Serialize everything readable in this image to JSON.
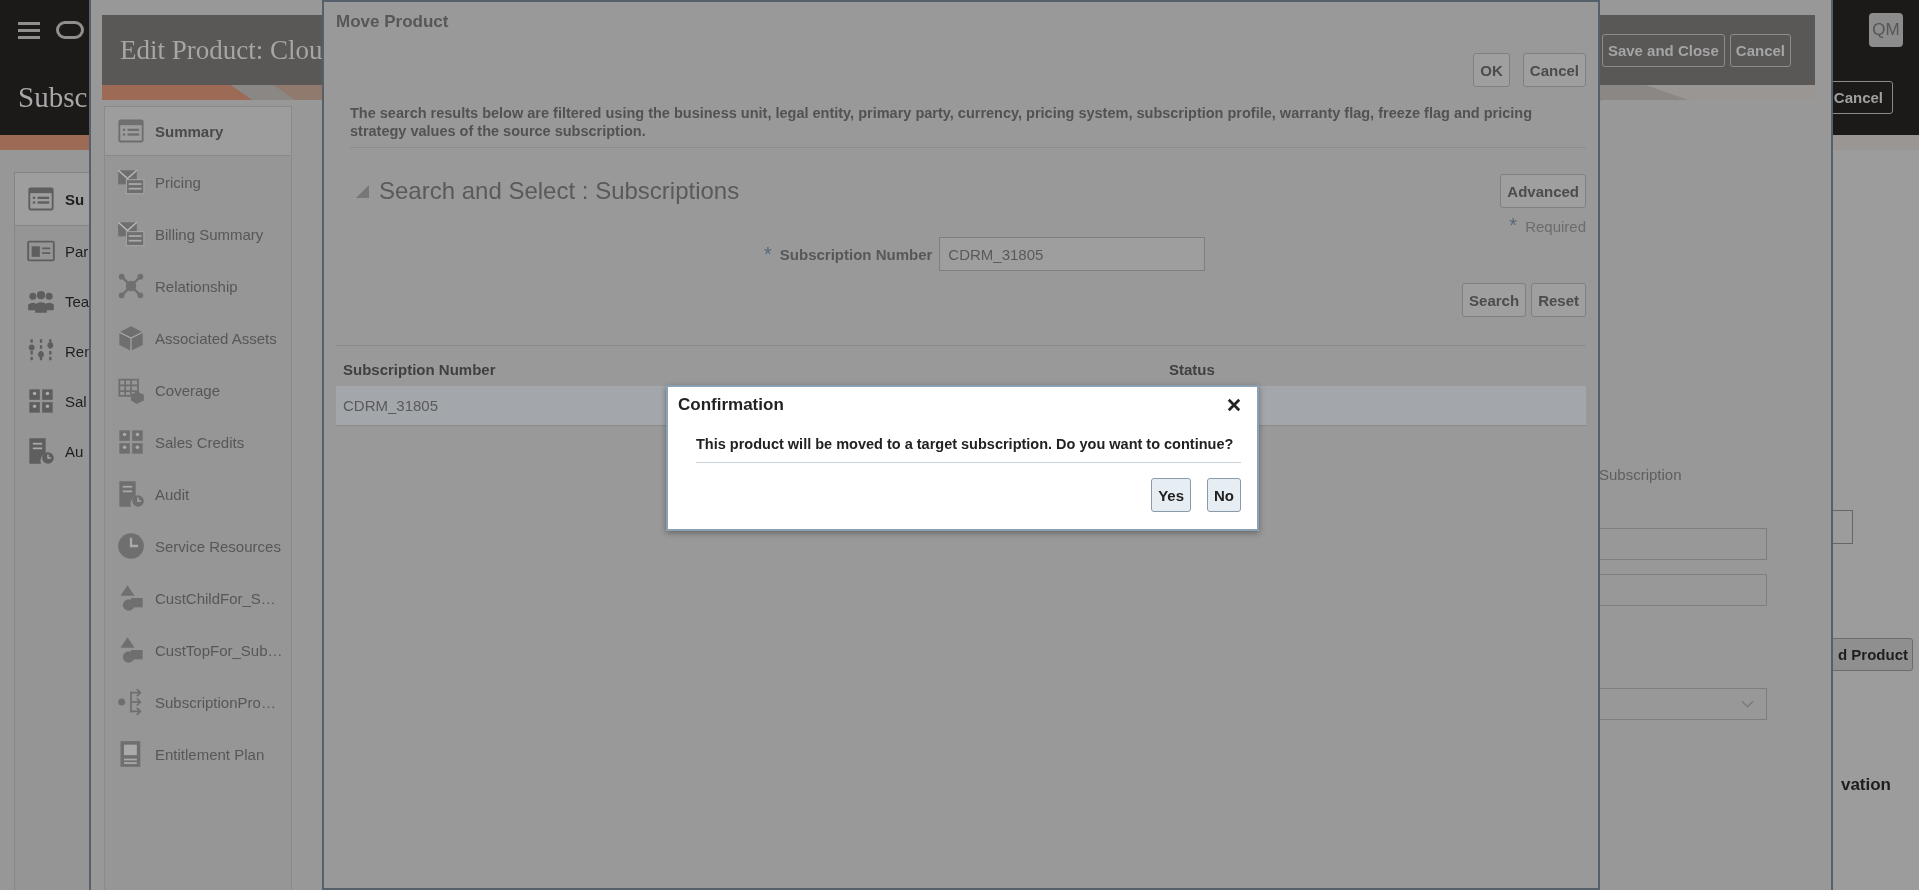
{
  "app_header": {
    "title": "Subsc",
    "user_initials": "QM",
    "cancel_button": {
      "label": "Cancel"
    }
  },
  "sidebar": {
    "items": [
      {
        "label": "Su",
        "selected": true
      },
      {
        "label": "Par",
        "selected": false
      },
      {
        "label": "Tea",
        "selected": false
      },
      {
        "label": "Ren",
        "selected": false
      },
      {
        "label": "Sal",
        "selected": false
      },
      {
        "label": "Au",
        "selected": false
      }
    ]
  },
  "background_content": {
    "add_product_button": "d Product",
    "column_heading": "vation"
  },
  "edit_product_drawer": {
    "title": "Edit Product: Clou",
    "buttons": [
      {
        "label": "Save and Close"
      },
      {
        "label": "Cancel"
      }
    ],
    "sidebar": {
      "items": [
        {
          "label": "Summary",
          "selected": true
        },
        {
          "label": "Pricing",
          "selected": false
        },
        {
          "label": "Billing Summary",
          "selected": false
        },
        {
          "label": "Relationship",
          "selected": false
        },
        {
          "label": "Associated Assets",
          "selected": false
        },
        {
          "label": "Coverage",
          "selected": false
        },
        {
          "label": "Sales Credits",
          "selected": false
        },
        {
          "label": "Audit",
          "selected": false
        },
        {
          "label": "Service Resources",
          "selected": false
        },
        {
          "label": "CustChildFor_S…",
          "selected": false
        },
        {
          "label": "CustTopFor_Sub…",
          "selected": false
        },
        {
          "label": "SubscriptionPro…",
          "selected": false
        },
        {
          "label": "Entitlement Plan",
          "selected": false
        }
      ]
    },
    "field_label": "Subscription"
  },
  "move_product_dialog": {
    "title": "Move Product",
    "buttons": [
      {
        "label": "OK"
      },
      {
        "label": "Cancel"
      }
    ],
    "description": "The search results below are filtered using the business unit, legal entity, primary party, currency, pricing system, subscription profile, warranty flag, freeze flag and pricing strategy values of the source subscription.",
    "search": {
      "title": "Search and Select : Subscriptions",
      "expanded": true,
      "advanced_button": {
        "label": "Advanced"
      },
      "required_mark": "*",
      "required_note": "Required",
      "field": {
        "required_mark": "*",
        "label": "Subscription Number",
        "value": "CDRM_31805"
      },
      "buttons": [
        {
          "label": "Search"
        },
        {
          "label": "Reset"
        }
      ]
    },
    "table": {
      "columns": [
        "Subscription Number",
        "Status"
      ],
      "rows": [
        {
          "cells": [
            "CDRM_31805"
          ],
          "selected": true
        }
      ]
    }
  },
  "confirmation": {
    "title": "Confirmation",
    "message": "This product will be moved to a target subscription. Do you want to continue?",
    "buttons": [
      {
        "label": "Yes"
      },
      {
        "label": "No"
      }
    ]
  }
}
